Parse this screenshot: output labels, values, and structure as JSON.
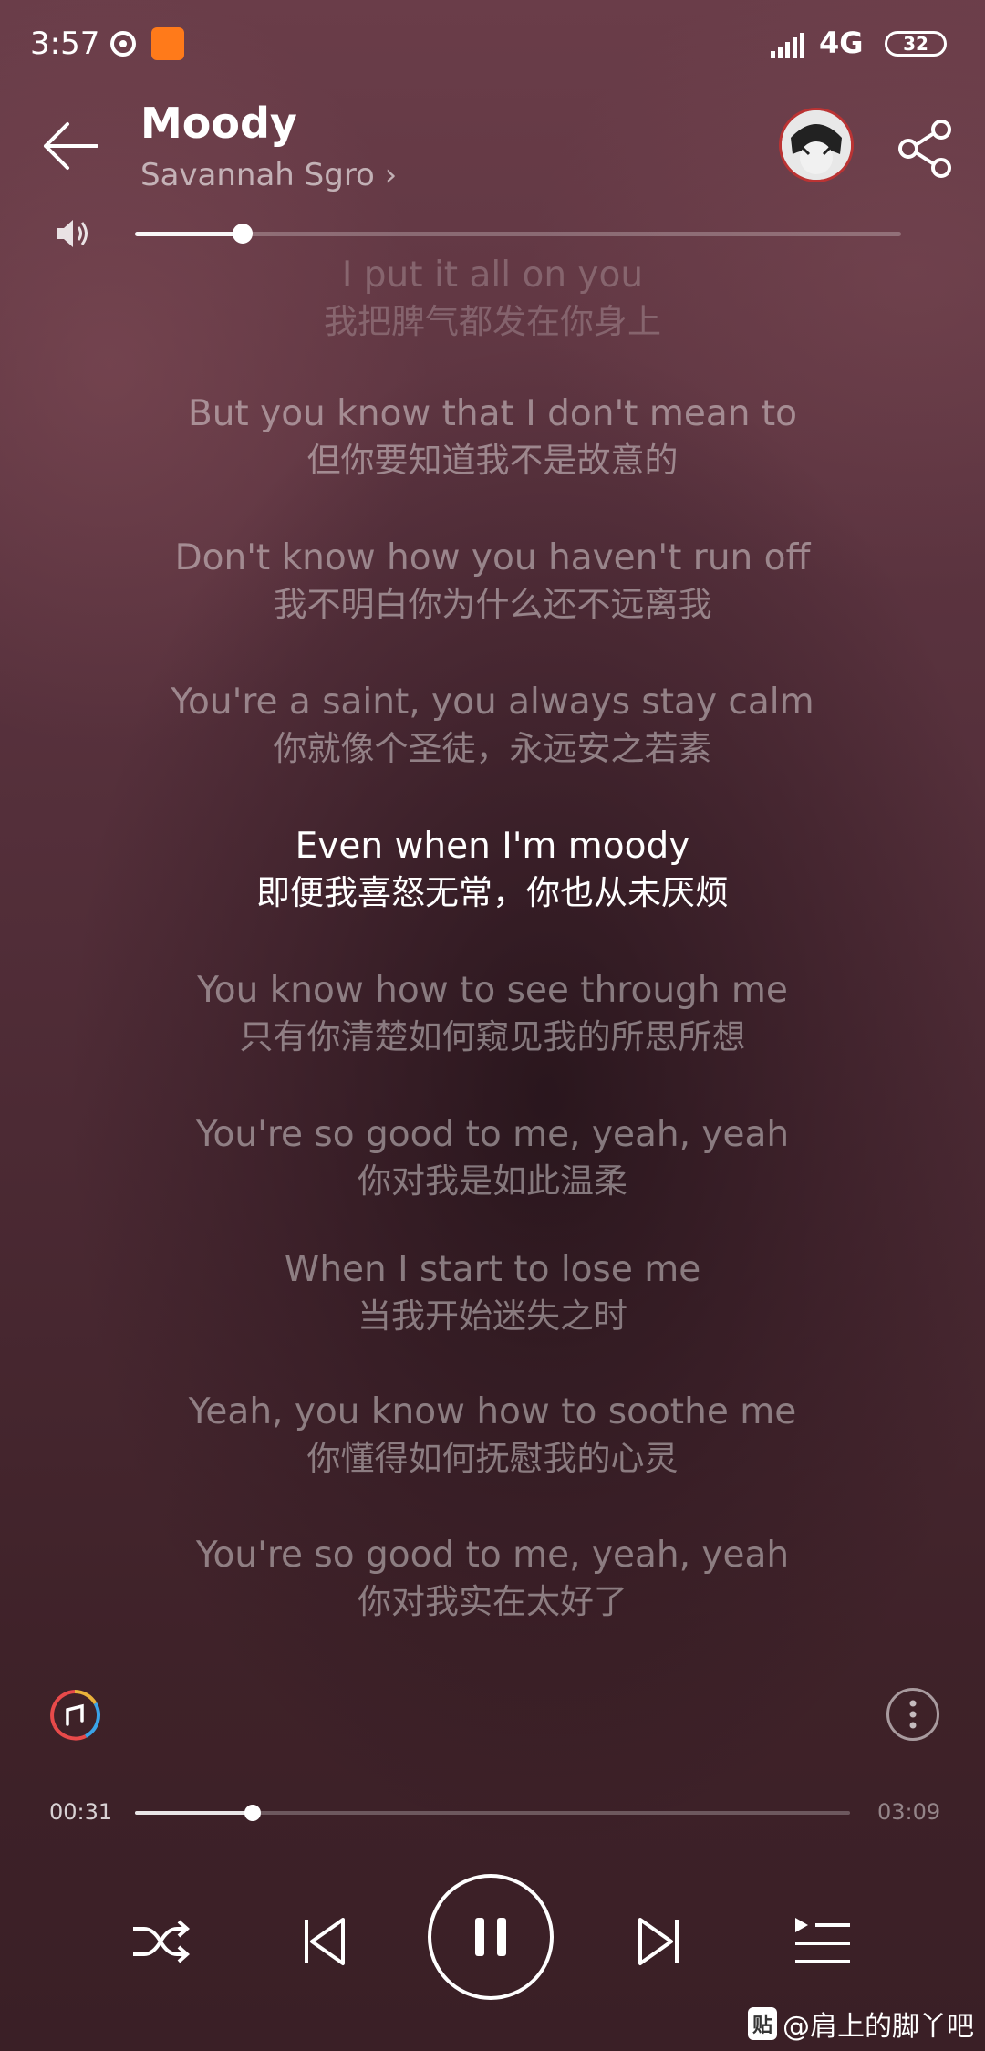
{
  "status_bar": {
    "time": "3:57",
    "network": "4G",
    "battery": "32"
  },
  "header": {
    "title": "Moody",
    "artist": "Savannah Sgro ›"
  },
  "volume": {
    "level": 0.14
  },
  "lyrics": [
    {
      "en": "I put it all on you",
      "zh": "我把脾气都发在你身上",
      "state": "faded"
    },
    {
      "en": "But you know that I don't mean to",
      "zh": "但你要知道我不是故意的",
      "state": "normal"
    },
    {
      "en": "Don't know how you haven't run off",
      "zh": "我不明白你为什么还不远离我",
      "state": "normal"
    },
    {
      "en": "You're a saint, you always stay calm",
      "zh": "你就像个圣徒，永远安之若素",
      "state": "normal"
    },
    {
      "en": "Even when I'm moody",
      "zh": "即便我喜怒无常，你也从未厌烦",
      "state": "active"
    },
    {
      "en": "You know how to see through me",
      "zh": "只有你清楚如何窥见我的所思所想",
      "state": "normal"
    },
    {
      "en": "You're so good to me, yeah, yeah",
      "zh": "你对我是如此温柔",
      "state": "normal"
    },
    {
      "en": "When I start to lose me",
      "zh": "当我开始迷失之时",
      "state": "normal"
    },
    {
      "en": "Yeah, you know how to soothe me",
      "zh": "你懂得如何抚慰我的心灵",
      "state": "normal"
    },
    {
      "en": "You're so good to me, yeah, yeah",
      "zh": "你对我实在太好了",
      "state": "normal"
    }
  ],
  "progress": {
    "current": "00:31",
    "total": "03:09",
    "fraction": 0.164
  },
  "watermark": {
    "badge": "贴",
    "text": "@肩上的脚丫吧"
  },
  "icons": {
    "back": "back-arrow-icon",
    "share": "share-icon",
    "volume": "speaker-icon",
    "mode": "music-mode-icon",
    "more": "more-vertical-icon",
    "shuffle": "shuffle-icon",
    "prev": "previous-icon",
    "pause": "pause-icon",
    "next": "next-icon",
    "playlist": "playlist-icon"
  }
}
